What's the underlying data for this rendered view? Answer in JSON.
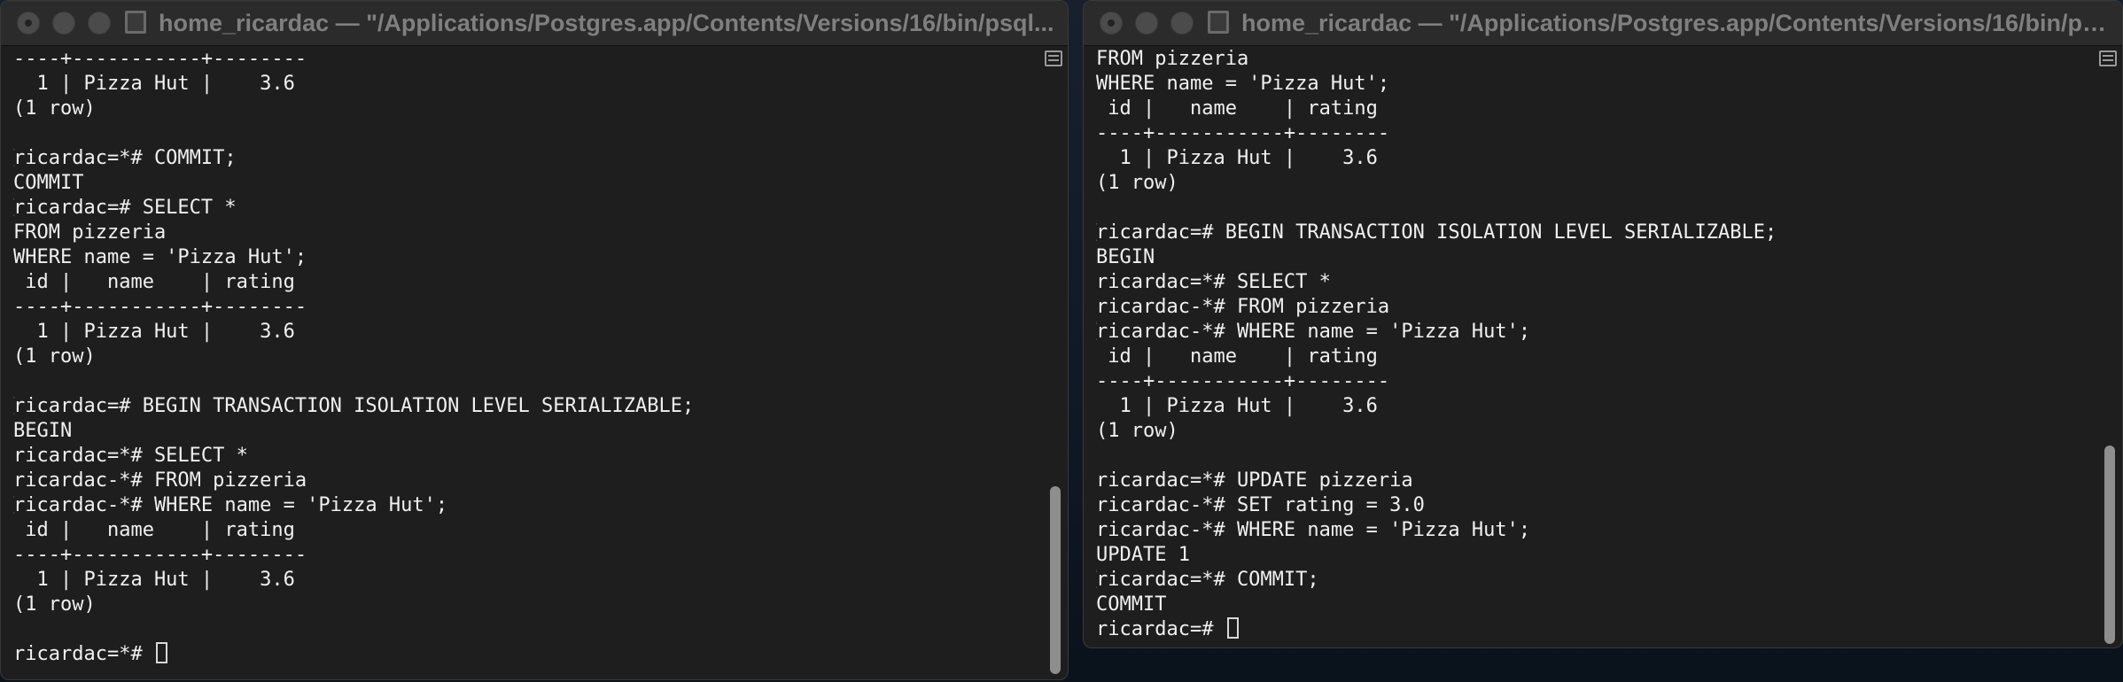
{
  "windows": {
    "left": {
      "title": "home_ricardac — \"/Applications/Postgres.app/Contents/Versions/16/bin/psql...",
      "lines": [
        "----+-----------+--------",
        "  1 | Pizza Hut |    3.6",
        "(1 row)",
        "",
        "ricardac=*# COMMIT;",
        "COMMIT",
        "ricardac=# SELECT *",
        "FROM pizzeria",
        "WHERE name = 'Pizza Hut';",
        " id |   name    | rating",
        "----+-----------+--------",
        "  1 | Pizza Hut |    3.6",
        "(1 row)",
        "",
        "ricardac=# BEGIN TRANSACTION ISOLATION LEVEL SERIALIZABLE;",
        "BEGIN",
        "ricardac=*# SELECT *",
        "ricardac-*# FROM pizzeria",
        "ricardac-*# WHERE name = 'Pizza Hut';",
        " id |   name    | rating",
        "----+-----------+--------",
        "  1 | Pizza Hut |    3.6",
        "(1 row)",
        "",
        "ricardac=*# "
      ]
    },
    "right": {
      "title": "home_ricardac — \"/Applications/Postgres.app/Contents/Versions/16/bin/ps...",
      "lines": [
        "FROM pizzeria",
        "WHERE name = 'Pizza Hut';",
        " id |   name    | rating",
        "----+-----------+--------",
        "  1 | Pizza Hut |    3.6",
        "(1 row)",
        "",
        "ricardac=# BEGIN TRANSACTION ISOLATION LEVEL SERIALIZABLE;",
        "BEGIN",
        "ricardac=*# SELECT *",
        "ricardac-*# FROM pizzeria",
        "ricardac-*# WHERE name = 'Pizza Hut';",
        " id |   name    | rating",
        "----+-----------+--------",
        "  1 | Pizza Hut |    3.6",
        "(1 row)",
        "",
        "ricardac=*# UPDATE pizzeria",
        "ricardac-*# SET rating = 3.0",
        "ricardac-*# WHERE name = 'Pizza Hut';",
        "UPDATE 1",
        "ricardac=*# COMMIT;",
        "COMMIT",
        "ricardac=# "
      ]
    }
  },
  "colors": {
    "terminal_bg": "#1e1e1e",
    "titlebar_bg": "#2b2b2b",
    "text": "#f0f0f0",
    "title_text": "#7f7f7f"
  }
}
